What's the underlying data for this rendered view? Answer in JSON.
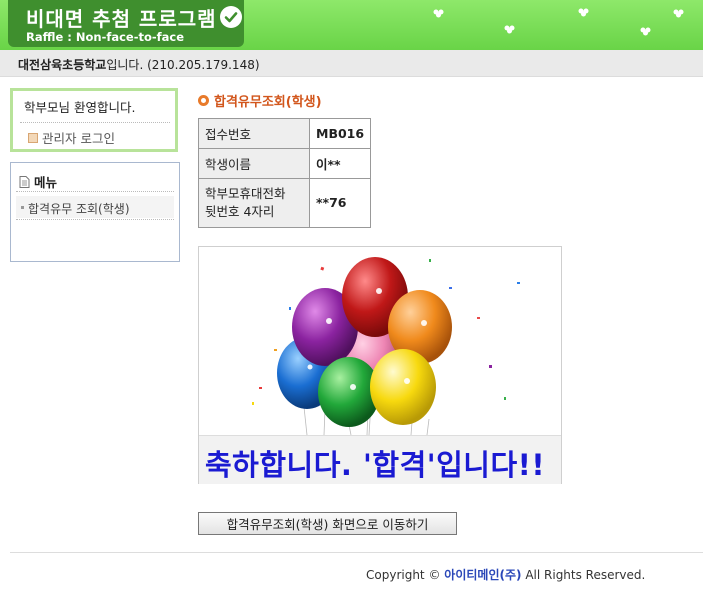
{
  "header": {
    "title": "비대면 추첨 프로그램",
    "subtitle": "Raffle : Non-face-to-face"
  },
  "infobar": {
    "school": "대전삼육초등학교",
    "suffix": "입니다.",
    "ip": "(210.205.179.148)"
  },
  "sidebar": {
    "welcome": "학부모님 환영합니다.",
    "admin_login": "관리자 로그인",
    "menu_title": "메뉴",
    "menu_items": [
      {
        "label": "합격유무 조회(학생)"
      }
    ]
  },
  "main": {
    "section_title": "합격유무조회(학생)",
    "rows": [
      {
        "label": "접수번호",
        "value": "MB016"
      },
      {
        "label": "학생이름",
        "value": "이**"
      },
      {
        "label_line1": "학부모휴대전화",
        "label_line2": "뒷번호 4자리",
        "value": "**76"
      }
    ],
    "congrats": "축하합니다. '합격'입니다!!",
    "move_button": "합격유무조회(학생) 화면으로 이동하기"
  },
  "footer": {
    "copyright_prefix": "Copyright ©",
    "company": "아이티메인(주)",
    "rights": "All Rights Reserved."
  },
  "colors": {
    "header_green": "#69d447",
    "logo_green": "#3f8f2e",
    "section_orange": "#d2561c",
    "congrats_blue": "#1a1ad2",
    "company_blue": "#2a47b8"
  }
}
